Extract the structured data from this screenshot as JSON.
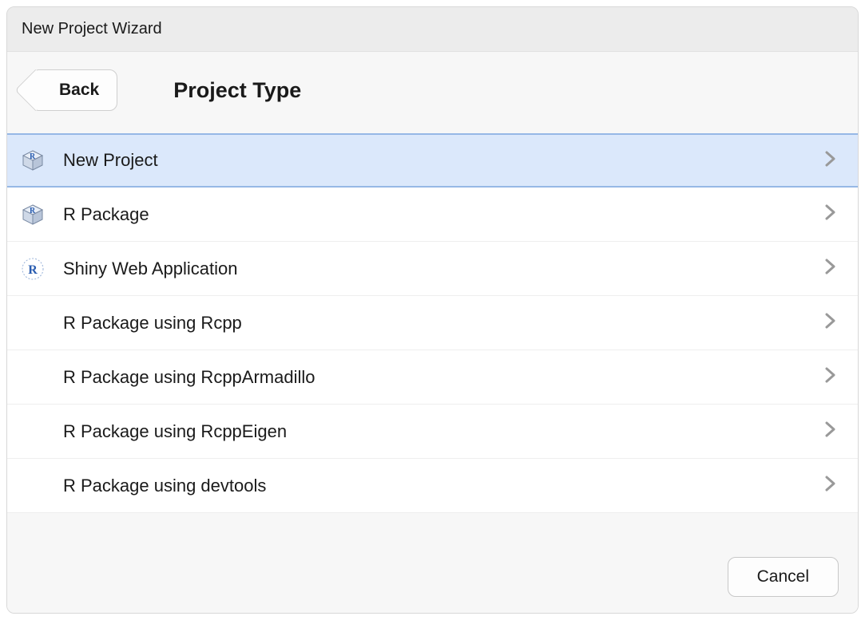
{
  "title_bar": "New Project Wizard",
  "back_label": "Back",
  "page_title": "Project Type",
  "items": [
    {
      "label": "New Project",
      "icon": "cube",
      "selected": true
    },
    {
      "label": "R Package",
      "icon": "cube",
      "selected": false
    },
    {
      "label": "Shiny Web Application",
      "icon": "r-circle",
      "selected": false
    },
    {
      "label": "R Package using Rcpp",
      "icon": "none",
      "selected": false
    },
    {
      "label": "R Package using RcppArmadillo",
      "icon": "none",
      "selected": false
    },
    {
      "label": "R Package using RcppEigen",
      "icon": "none",
      "selected": false
    },
    {
      "label": "R Package using devtools",
      "icon": "none",
      "selected": false
    }
  ],
  "cancel_label": "Cancel"
}
